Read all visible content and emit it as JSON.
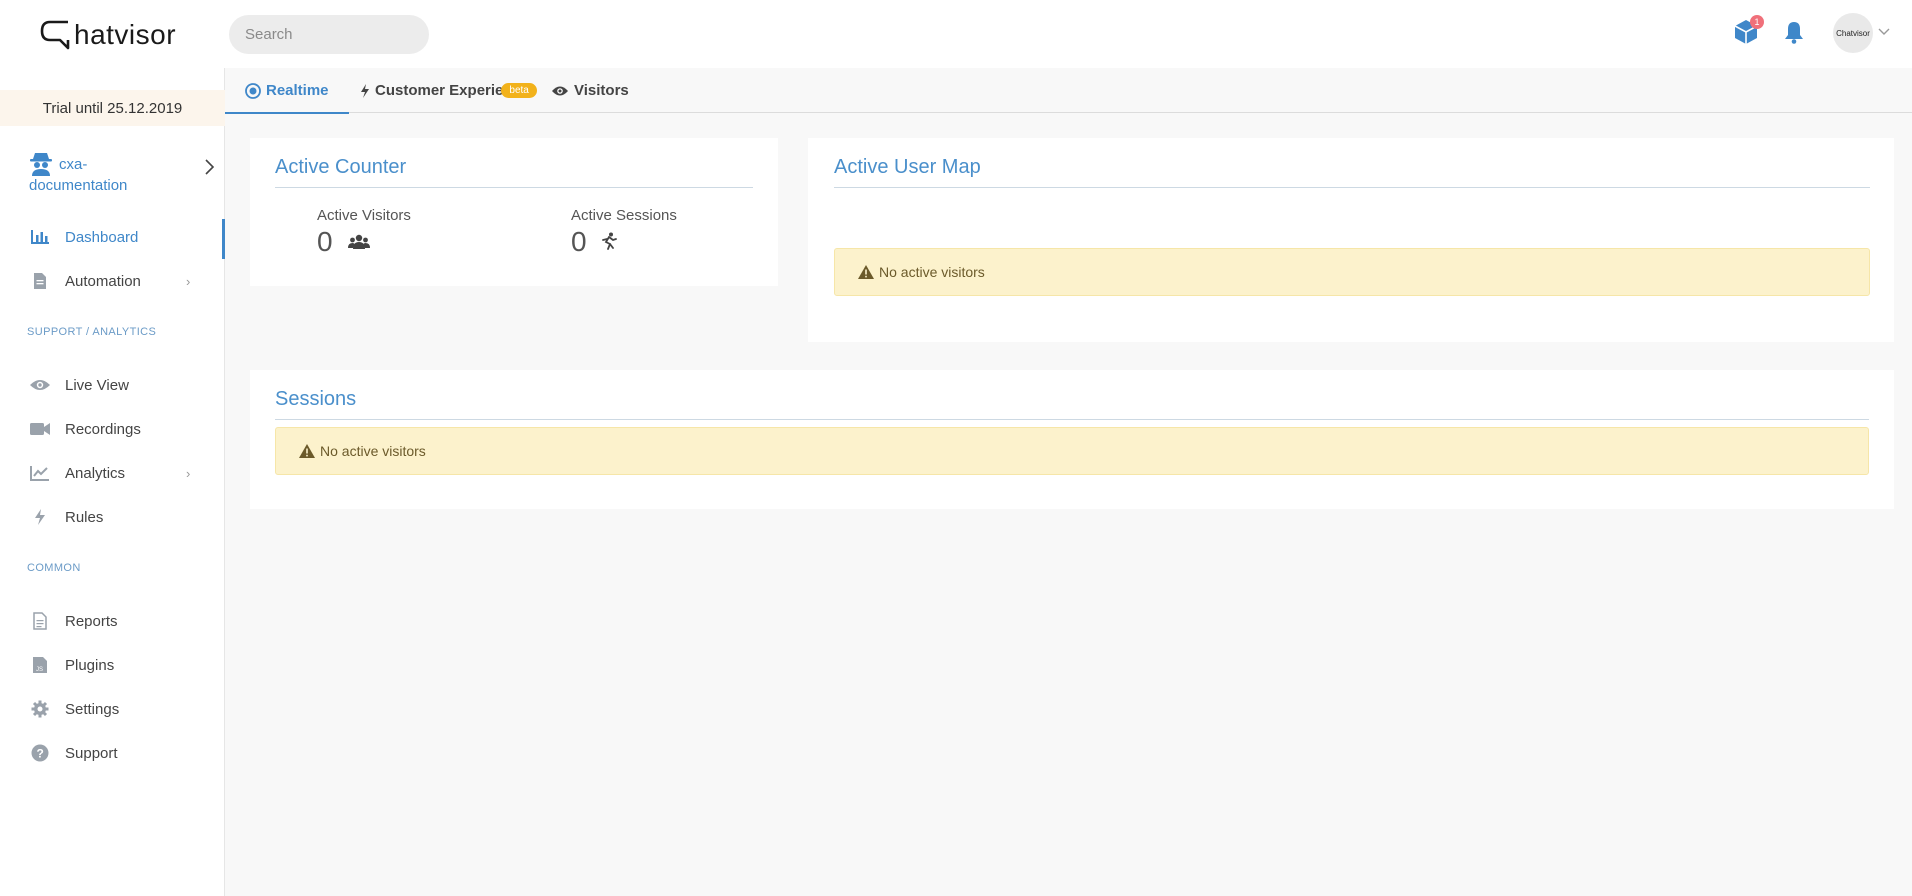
{
  "header": {
    "logo_text": "hatvisor",
    "search_placeholder": "Search",
    "notification_count": "1",
    "avatar_text": "Chatvisor",
    "icons": [
      "cube-icon",
      "bell-icon",
      "chevron-down-icon"
    ]
  },
  "sidebar": {
    "trial_text": "Trial until 25.12.2019",
    "account_name": "cxa-documentation",
    "items_main": [
      {
        "label": "Dashboard",
        "icon": "bar-chart-icon",
        "active": true
      },
      {
        "label": "Automation",
        "icon": "document-icon",
        "has_submenu": true
      }
    ],
    "section_support": "SUPPORT / ANALYTICS",
    "items_support": [
      {
        "label": "Live View",
        "icon": "eye-icon"
      },
      {
        "label": "Recordings",
        "icon": "video-camera-icon"
      },
      {
        "label": "Analytics",
        "icon": "line-chart-icon",
        "has_submenu": true
      },
      {
        "label": "Rules",
        "icon": "bolt-icon"
      }
    ],
    "section_common": "COMMON",
    "items_common": [
      {
        "label": "Reports",
        "icon": "report-icon"
      },
      {
        "label": "Plugins",
        "icon": "js-file-icon"
      },
      {
        "label": "Settings",
        "icon": "gear-icon"
      },
      {
        "label": "Support",
        "icon": "question-icon"
      }
    ]
  },
  "tabs": [
    {
      "label": "Realtime",
      "icon": "realtime-icon",
      "active": true
    },
    {
      "label": "Customer Experie",
      "badge": "beta",
      "icon": "bolt-icon"
    },
    {
      "label": "Visitors",
      "icon": "eye-icon"
    }
  ],
  "active_counter": {
    "title": "Active Counter",
    "visitors_label": "Active Visitors",
    "visitors_value": "0",
    "sessions_label": "Active Sessions",
    "sessions_value": "0"
  },
  "active_user_map": {
    "title": "Active User Map",
    "alert": "No active visitors"
  },
  "sessions": {
    "title": "Sessions",
    "alert": "No active visitors"
  },
  "colors": {
    "accent": "#3f87c9",
    "alert_bg": "#fcf2cc",
    "beta_badge": "#f2b21b",
    "trial_bg": "#fcf5ec"
  }
}
